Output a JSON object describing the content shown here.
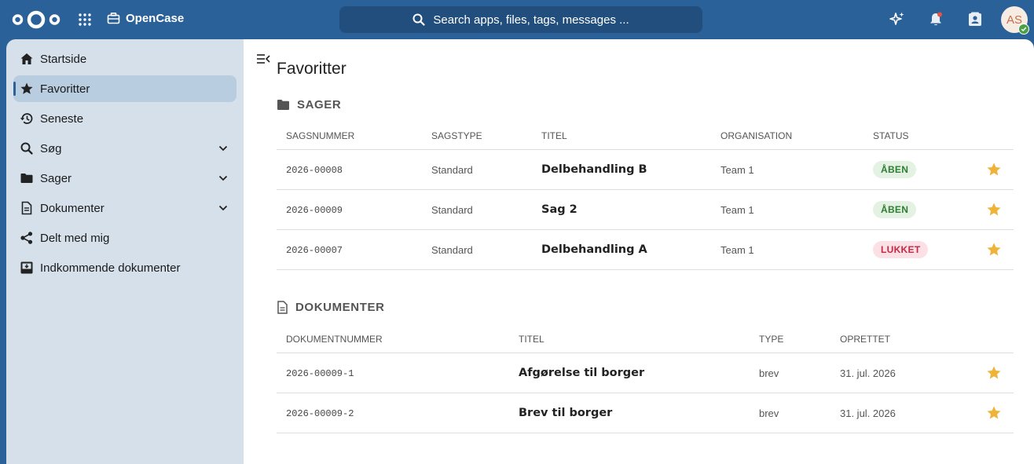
{
  "header": {
    "app_name": "OpenCase",
    "search_placeholder": "Search apps, files, tags, messages ...",
    "avatar_initials": "AS"
  },
  "sidebar": {
    "items": [
      {
        "label": "Startside",
        "icon": "home-icon"
      },
      {
        "label": "Favoritter",
        "icon": "star-icon",
        "active": true
      },
      {
        "label": "Seneste",
        "icon": "history-icon"
      },
      {
        "label": "Søg",
        "icon": "search-icon",
        "expandable": true
      },
      {
        "label": "Sager",
        "icon": "folder-icon",
        "expandable": true
      },
      {
        "label": "Dokumenter",
        "icon": "document-icon",
        "expandable": true
      },
      {
        "label": "Delt med mig",
        "icon": "share-icon"
      },
      {
        "label": "Indkommende dokumenter",
        "icon": "inbox-icon"
      }
    ]
  },
  "main": {
    "title": "Favoritter",
    "cases": {
      "title": "SAGER",
      "columns": [
        "SAGSNUMMER",
        "SAGSTYPE",
        "TITEL",
        "ORGANISATION",
        "STATUS"
      ],
      "rows": [
        {
          "number": "2026-00008",
          "type": "Standard",
          "title": "Delbehandling B",
          "org": "Team 1",
          "status": "ÅBEN",
          "status_kind": "open"
        },
        {
          "number": "2026-00009",
          "type": "Standard",
          "title": "Sag 2",
          "org": "Team 1",
          "status": "ÅBEN",
          "status_kind": "open"
        },
        {
          "number": "2026-00007",
          "type": "Standard",
          "title": "Delbehandling A",
          "org": "Team 1",
          "status": "LUKKET",
          "status_kind": "closed"
        }
      ]
    },
    "documents": {
      "title": "DOKUMENTER",
      "columns": [
        "DOKUMENTNUMMER",
        "TITEL",
        "TYPE",
        "OPRETTET"
      ],
      "rows": [
        {
          "number": "2026-00009-1",
          "title": "Afgørelse til borger",
          "type": "brev",
          "created": "31. jul. 2026"
        },
        {
          "number": "2026-00009-2",
          "title": "Brev til borger",
          "type": "brev",
          "created": "31. jul. 2026"
        }
      ]
    }
  },
  "colors": {
    "header_bg": "#2a6199",
    "sidebar_bg": "#d5e0eb",
    "star": "#f0b33a",
    "open_badge": "#2e7d32",
    "closed_badge": "#c62845"
  }
}
